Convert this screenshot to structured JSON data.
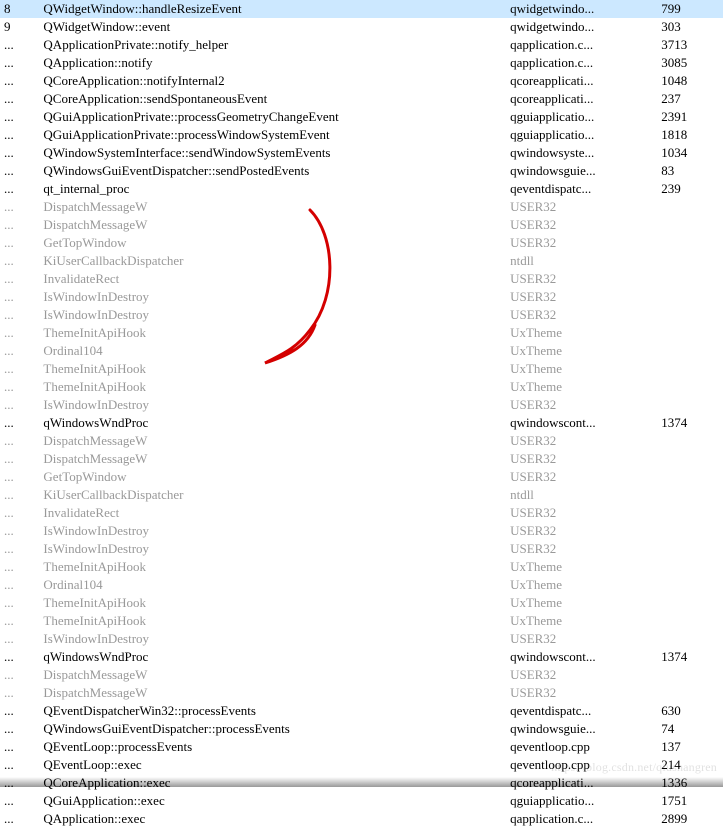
{
  "watermark": "https://blog.csdn.net/qiushangren",
  "rows": [
    {
      "depth": "8",
      "func": "QWidgetWindow::handleResizeEvent",
      "module": "qwidgetwindo...",
      "line": "799",
      "dimmed": false,
      "selected": true
    },
    {
      "depth": "9",
      "func": "QWidgetWindow::event",
      "module": "qwidgetwindo...",
      "line": "303",
      "dimmed": false,
      "selected": false
    },
    {
      "depth": "...",
      "func": "QApplicationPrivate::notify_helper",
      "module": "qapplication.c...",
      "line": "3713",
      "dimmed": false,
      "selected": false
    },
    {
      "depth": "...",
      "func": "QApplication::notify",
      "module": "qapplication.c...",
      "line": "3085",
      "dimmed": false,
      "selected": false
    },
    {
      "depth": "...",
      "func": "QCoreApplication::notifyInternal2",
      "module": "qcoreapplicati...",
      "line": "1048",
      "dimmed": false,
      "selected": false
    },
    {
      "depth": "...",
      "func": "QCoreApplication::sendSpontaneousEvent",
      "module": "qcoreapplicati...",
      "line": "237",
      "dimmed": false,
      "selected": false
    },
    {
      "depth": "...",
      "func": "QGuiApplicationPrivate::processGeometryChangeEvent",
      "module": "qguiapplicatio...",
      "line": "2391",
      "dimmed": false,
      "selected": false
    },
    {
      "depth": "...",
      "func": "QGuiApplicationPrivate::processWindowSystemEvent",
      "module": "qguiapplicatio...",
      "line": "1818",
      "dimmed": false,
      "selected": false
    },
    {
      "depth": "...",
      "func": "QWindowSystemInterface::sendWindowSystemEvents",
      "module": "qwindowsyste...",
      "line": "1034",
      "dimmed": false,
      "selected": false
    },
    {
      "depth": "...",
      "func": "QWindowsGuiEventDispatcher::sendPostedEvents",
      "module": "qwindowsguie...",
      "line": "83",
      "dimmed": false,
      "selected": false
    },
    {
      "depth": "...",
      "func": "qt_internal_proc",
      "module": "qeventdispatc...",
      "line": "239",
      "dimmed": false,
      "selected": false
    },
    {
      "depth": "...",
      "func": "DispatchMessageW",
      "module": "USER32",
      "line": "",
      "dimmed": true,
      "selected": false
    },
    {
      "depth": "...",
      "func": "DispatchMessageW",
      "module": "USER32",
      "line": "",
      "dimmed": true,
      "selected": false
    },
    {
      "depth": "...",
      "func": "GetTopWindow",
      "module": "USER32",
      "line": "",
      "dimmed": true,
      "selected": false
    },
    {
      "depth": "...",
      "func": "KiUserCallbackDispatcher",
      "module": "ntdll",
      "line": "",
      "dimmed": true,
      "selected": false
    },
    {
      "depth": "...",
      "func": "InvalidateRect",
      "module": "USER32",
      "line": "",
      "dimmed": true,
      "selected": false
    },
    {
      "depth": "...",
      "func": "IsWindowInDestroy",
      "module": "USER32",
      "line": "",
      "dimmed": true,
      "selected": false
    },
    {
      "depth": "...",
      "func": "IsWindowInDestroy",
      "module": "USER32",
      "line": "",
      "dimmed": true,
      "selected": false
    },
    {
      "depth": "...",
      "func": "ThemeInitApiHook",
      "module": "UxTheme",
      "line": "",
      "dimmed": true,
      "selected": false
    },
    {
      "depth": "...",
      "func": "Ordinal104",
      "module": "UxTheme",
      "line": "",
      "dimmed": true,
      "selected": false
    },
    {
      "depth": "...",
      "func": "ThemeInitApiHook",
      "module": "UxTheme",
      "line": "",
      "dimmed": true,
      "selected": false
    },
    {
      "depth": "...",
      "func": "ThemeInitApiHook",
      "module": "UxTheme",
      "line": "",
      "dimmed": true,
      "selected": false
    },
    {
      "depth": "...",
      "func": "IsWindowInDestroy",
      "module": "USER32",
      "line": "",
      "dimmed": true,
      "selected": false
    },
    {
      "depth": "...",
      "func": "qWindowsWndProc",
      "module": "qwindowscont...",
      "line": "1374",
      "dimmed": false,
      "selected": false
    },
    {
      "depth": "...",
      "func": "DispatchMessageW",
      "module": "USER32",
      "line": "",
      "dimmed": true,
      "selected": false
    },
    {
      "depth": "...",
      "func": "DispatchMessageW",
      "module": "USER32",
      "line": "",
      "dimmed": true,
      "selected": false
    },
    {
      "depth": "...",
      "func": "GetTopWindow",
      "module": "USER32",
      "line": "",
      "dimmed": true,
      "selected": false
    },
    {
      "depth": "...",
      "func": "KiUserCallbackDispatcher",
      "module": "ntdll",
      "line": "",
      "dimmed": true,
      "selected": false
    },
    {
      "depth": "...",
      "func": "InvalidateRect",
      "module": "USER32",
      "line": "",
      "dimmed": true,
      "selected": false
    },
    {
      "depth": "...",
      "func": "IsWindowInDestroy",
      "module": "USER32",
      "line": "",
      "dimmed": true,
      "selected": false
    },
    {
      "depth": "...",
      "func": "IsWindowInDestroy",
      "module": "USER32",
      "line": "",
      "dimmed": true,
      "selected": false
    },
    {
      "depth": "...",
      "func": "ThemeInitApiHook",
      "module": "UxTheme",
      "line": "",
      "dimmed": true,
      "selected": false
    },
    {
      "depth": "...",
      "func": "Ordinal104",
      "module": "UxTheme",
      "line": "",
      "dimmed": true,
      "selected": false
    },
    {
      "depth": "...",
      "func": "ThemeInitApiHook",
      "module": "UxTheme",
      "line": "",
      "dimmed": true,
      "selected": false
    },
    {
      "depth": "...",
      "func": "ThemeInitApiHook",
      "module": "UxTheme",
      "line": "",
      "dimmed": true,
      "selected": false
    },
    {
      "depth": "...",
      "func": "IsWindowInDestroy",
      "module": "USER32",
      "line": "",
      "dimmed": true,
      "selected": false
    },
    {
      "depth": "...",
      "func": "qWindowsWndProc",
      "module": "qwindowscont...",
      "line": "1374",
      "dimmed": false,
      "selected": false
    },
    {
      "depth": "...",
      "func": "DispatchMessageW",
      "module": "USER32",
      "line": "",
      "dimmed": true,
      "selected": false
    },
    {
      "depth": "...",
      "func": "DispatchMessageW",
      "module": "USER32",
      "line": "",
      "dimmed": true,
      "selected": false
    },
    {
      "depth": "...",
      "func": "QEventDispatcherWin32::processEvents",
      "module": "qeventdispatc...",
      "line": "630",
      "dimmed": false,
      "selected": false
    },
    {
      "depth": "...",
      "func": "QWindowsGuiEventDispatcher::processEvents",
      "module": "qwindowsguie...",
      "line": "74",
      "dimmed": false,
      "selected": false
    },
    {
      "depth": "...",
      "func": "QEventLoop::processEvents",
      "module": "qeventloop.cpp",
      "line": "137",
      "dimmed": false,
      "selected": false
    },
    {
      "depth": "...",
      "func": "QEventLoop::exec",
      "module": "qeventloop.cpp",
      "line": "214",
      "dimmed": false,
      "selected": false
    },
    {
      "depth": "...",
      "func": "QCoreApplication::exec",
      "module": "qcoreapplicati...",
      "line": "1336",
      "dimmed": false,
      "selected": false
    },
    {
      "depth": "...",
      "func": "QGuiApplication::exec",
      "module": "qguiapplicatio...",
      "line": "1751",
      "dimmed": false,
      "selected": false
    },
    {
      "depth": "...",
      "func": "QApplication::exec",
      "module": "qapplication.c...",
      "line": "2899",
      "dimmed": false,
      "selected": false
    }
  ]
}
